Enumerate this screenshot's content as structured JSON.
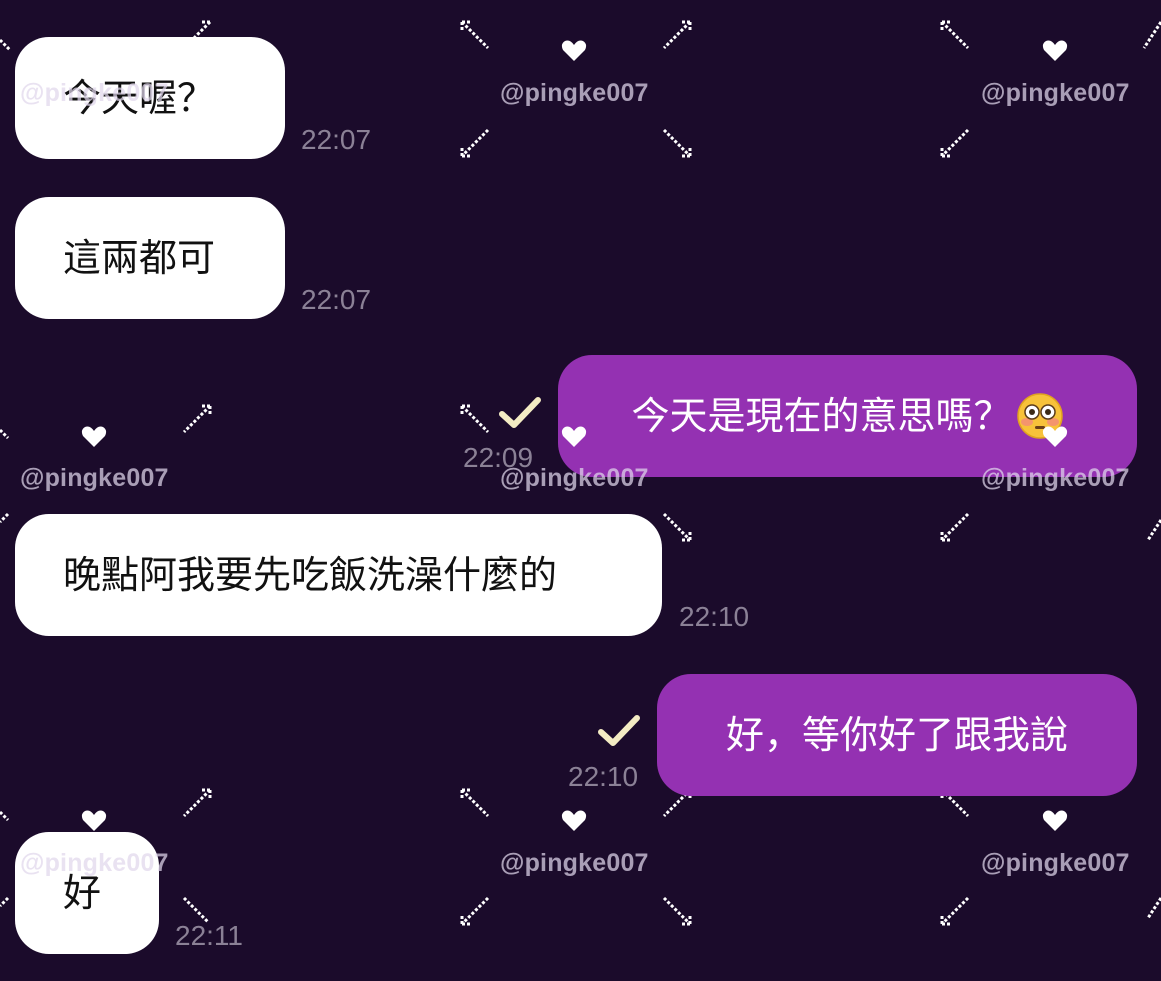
{
  "colors": {
    "background": "#1b0b2b",
    "incoming_bubble": "#ffffff",
    "outgoing_bubble": "#9431b2",
    "timestamp": "#8b8196",
    "read_check": "#f4ecc4"
  },
  "watermark": "@pingke007",
  "messages": [
    {
      "direction": "incoming",
      "text": "今天喔？",
      "time": "22:07"
    },
    {
      "direction": "incoming",
      "text": "這兩都可",
      "time": "22:07"
    },
    {
      "direction": "outgoing",
      "text": "今天是現在的意思嗎？",
      "emoji": "flushed-face-icon",
      "time": "22:09",
      "read": true
    },
    {
      "direction": "incoming",
      "text": "晚點阿我要先吃飯洗澡什麼的",
      "time": "22:10"
    },
    {
      "direction": "outgoing",
      "text": "好，等你好了跟我說",
      "time": "22:10",
      "read": true
    },
    {
      "direction": "incoming",
      "text": "好",
      "time": "22:11"
    }
  ]
}
